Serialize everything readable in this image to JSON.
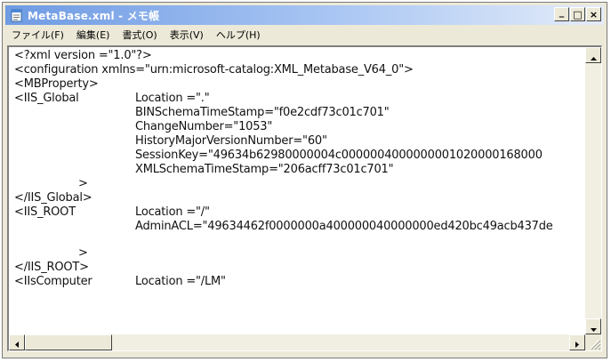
{
  "window": {
    "title": "MetaBase.xml - メモ帳",
    "minimize_label": "_",
    "maximize_label": "□",
    "close_label": "×"
  },
  "menu": {
    "items": [
      "ファイル(F)",
      "編集(E)",
      "書式(O)",
      "表示(V)",
      "ヘルプ(H)"
    ]
  },
  "document": {
    "lines": [
      "<?xml version =\"1.0\"?>",
      "<configuration xmlns=\"urn:microsoft-catalog:XML_Metabase_V64_0\">",
      "<MBProperty>",
      "<IIS_Global",
      "Location =\".\"",
      "BINSchemaTimeStamp=\"f0e2cdf73c01c701\"",
      "ChangeNumber=\"1053\"",
      "HistoryMajorVersionNumber=\"60\"",
      "SessionKey=\"49634b62980000004c0000004000000001020000168000",
      "XMLSchemaTimeStamp=\"206acff73c01c701\"",
      ">",
      "</IIS_Global>",
      "<IIS_ROOT",
      "Location =\"/\"",
      "AdminACL=\"49634462f0000000a400000040000000ed420bc49acb437de",
      ">",
      "</IIS_ROOT>",
      "<IIsComputer",
      "Location =\"/LM\""
    ]
  },
  "icons": {
    "app": "notepad-icon",
    "scroll_up": "arrow-up-icon",
    "scroll_down": "arrow-down-icon",
    "scroll_left": "arrow-left-icon",
    "scroll_right": "arrow-right-icon",
    "grip": "resize-grip-icon"
  },
  "colors": {
    "titlebar_start": "#6f9be3",
    "titlebar_end": "#e4ecf9",
    "chrome": "#ece9d8"
  }
}
